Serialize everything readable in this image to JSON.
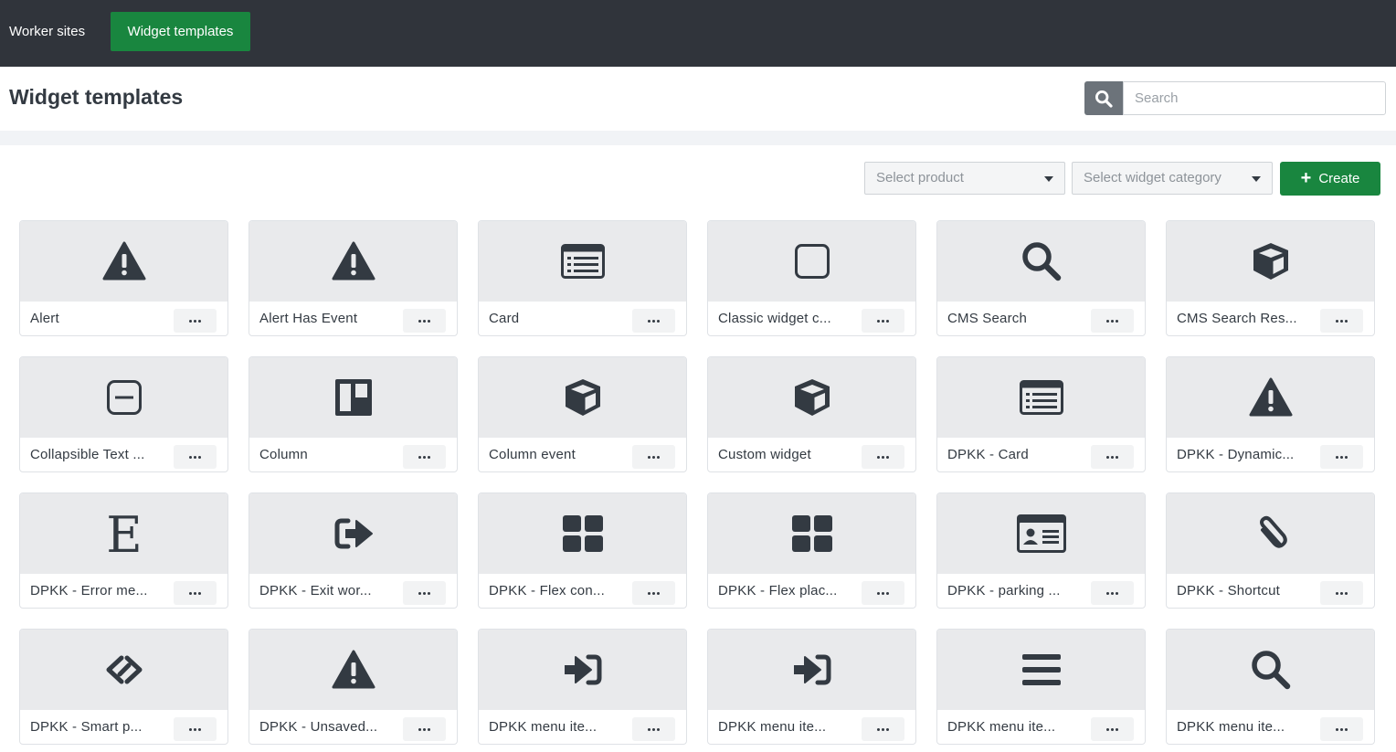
{
  "nav": {
    "worker_sites": "Worker sites",
    "widget_templates": "Widget templates"
  },
  "header": {
    "title": "Widget templates",
    "search_placeholder": "Search"
  },
  "toolbar": {
    "select_product": "Select product",
    "select_category": "Select widget category",
    "create_label": "Create"
  },
  "colors": {
    "nav_bg": "#30343b",
    "accent_green": "#19863f",
    "icon": "#333a42",
    "card_top": "#e9eaec"
  },
  "cards": [
    {
      "label": "Alert",
      "icon": "warning-icon"
    },
    {
      "label": "Alert Has Event",
      "icon": "warning-icon"
    },
    {
      "label": "Card",
      "icon": "list-card-icon"
    },
    {
      "label": "Classic widget c...",
      "icon": "square-icon"
    },
    {
      "label": "CMS Search",
      "icon": "search-icon"
    },
    {
      "label": "CMS Search Res...",
      "icon": "cube-icon"
    },
    {
      "label": "Collapsible Text ...",
      "icon": "minus-square-icon"
    },
    {
      "label": "Column",
      "icon": "columns-icon"
    },
    {
      "label": "Column event",
      "icon": "cube-icon"
    },
    {
      "label": "Custom widget",
      "icon": "cube-icon"
    },
    {
      "label": "DPKK - Card",
      "icon": "list-card-icon"
    },
    {
      "label": "DPKK - Dynamic...",
      "icon": "warning-icon"
    },
    {
      "label": "DPKK - Error me...",
      "icon": "letter-e-icon"
    },
    {
      "label": "DPKK - Exit wor...",
      "icon": "sign-out-icon"
    },
    {
      "label": "DPKK - Flex con...",
      "icon": "grid-icon"
    },
    {
      "label": "DPKK - Flex plac...",
      "icon": "grid-icon"
    },
    {
      "label": "DPKK - parking ...",
      "icon": "id-card-icon"
    },
    {
      "label": "DPKK - Shortcut",
      "icon": "paperclip-icon"
    },
    {
      "label": "DPKK - Smart p...",
      "icon": "link-diamond-icon"
    },
    {
      "label": "DPKK - Unsaved...",
      "icon": "warning-icon"
    },
    {
      "label": "DPKK menu ite...",
      "icon": "sign-in-icon"
    },
    {
      "label": "DPKK menu ite...",
      "icon": "sign-in-icon"
    },
    {
      "label": "DPKK menu ite...",
      "icon": "bars-icon"
    },
    {
      "label": "DPKK menu ite...",
      "icon": "search-icon"
    }
  ]
}
